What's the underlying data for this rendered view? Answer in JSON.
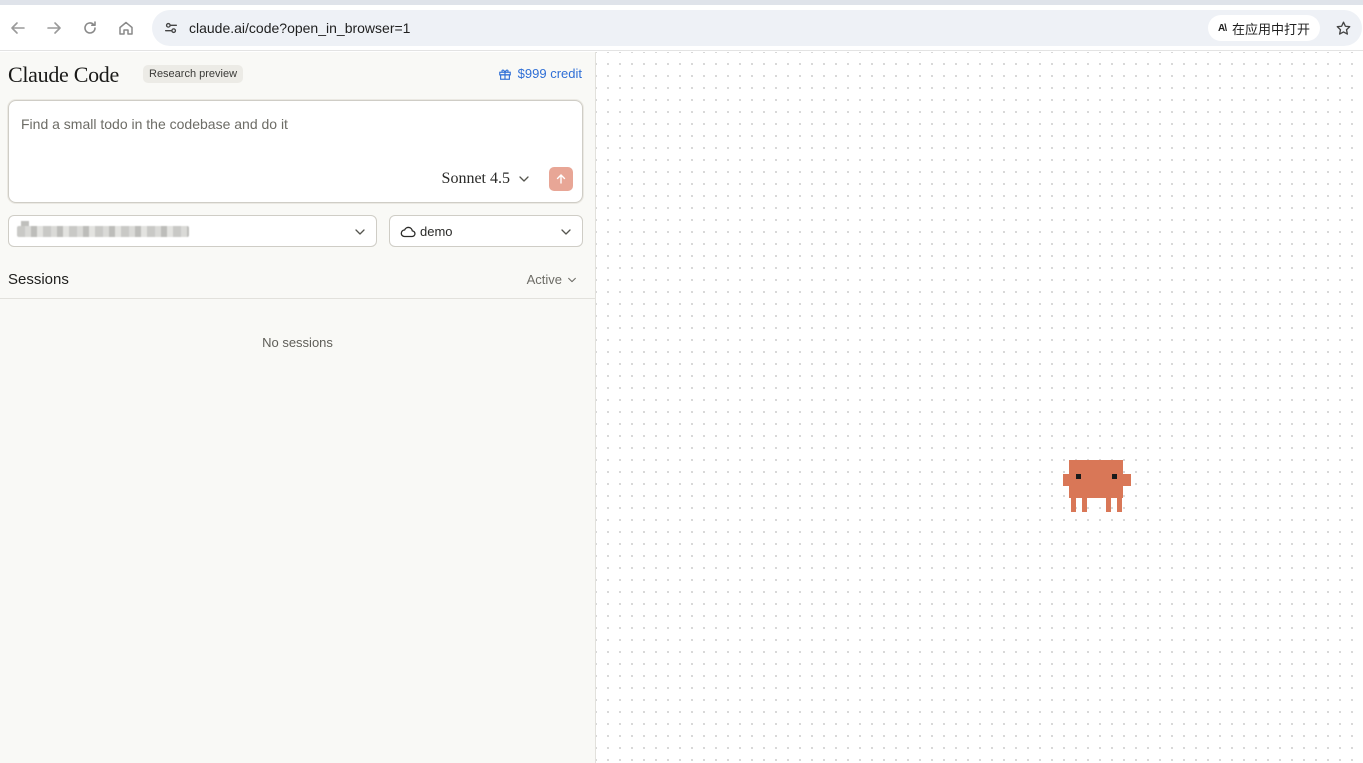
{
  "browser": {
    "url": "claude.ai/code?open_in_browser=1",
    "open_in_app_label": "在应用中打开",
    "icons": {
      "back": "arrow-left-icon",
      "forward": "arrow-right-icon",
      "reload": "reload-icon",
      "home": "home-icon",
      "site_info": "tune-icon",
      "open_app": "app-icon",
      "bookmark": "star-icon"
    }
  },
  "header": {
    "brand": "Claude Code",
    "badge": "Research preview",
    "credit": "$999 credit",
    "credit_icon": "gift-icon"
  },
  "composer": {
    "placeholder": "Find a small todo in the codebase and do it",
    "model": "Sonnet 4.5",
    "send_icon": "arrow-up-icon"
  },
  "selectors": {
    "repository": {
      "value": ""
    },
    "environment": {
      "value": "demo",
      "icon": "cloud-icon"
    }
  },
  "sessions": {
    "title": "Sessions",
    "filter": "Active",
    "empty_text": "No sessions"
  },
  "colors": {
    "accent_link": "#2f6fd6",
    "send_button": "#e8a696",
    "mascot": "#d97757",
    "panel_bg": "#f9f9f6"
  }
}
